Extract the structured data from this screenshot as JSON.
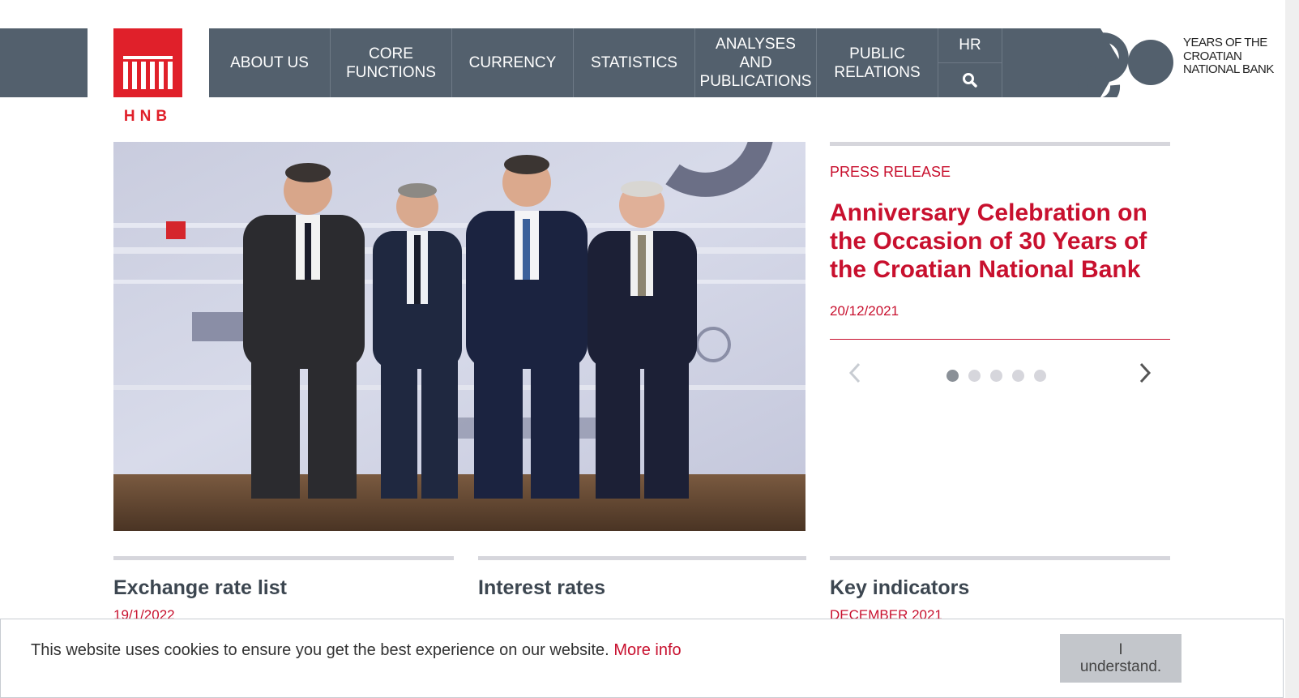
{
  "brand": {
    "logo_text": "HNB",
    "anniversary_number": "30",
    "anniversary_text": "YEARS OF THE CROATIAN NATIONAL BANK",
    "red": "#e0202a",
    "nav_bg": "#53606d"
  },
  "nav": {
    "items": [
      {
        "label": "ABOUT US"
      },
      {
        "label": "CORE\nFUNCTIONS"
      },
      {
        "label": "CURRENCY"
      },
      {
        "label": "STATISTICS"
      },
      {
        "label": "ANALYSES\nAND\nPUBLICATIONS"
      },
      {
        "label": "PUBLIC\nRELATIONS"
      }
    ],
    "language": "HR",
    "search_icon": "search-icon"
  },
  "hero": {
    "image": "photo-four-men-in-suits"
  },
  "press": {
    "label": "PRESS RELEASE",
    "title": "Anniversary Celebration on the Occasion of 30 Years of the Croatian National Bank",
    "date": "20/12/2021",
    "slide_count": 5,
    "active_slide": 1
  },
  "sections": [
    {
      "title": "Exchange rate list",
      "subtitle": "19/1/2022"
    },
    {
      "title": "Interest rates",
      "subtitle": ""
    },
    {
      "title": "Key indicators",
      "subtitle": "DECEMBER 2021"
    }
  ],
  "cookie": {
    "text": "This website uses cookies to ensure you get the best experience on our website.",
    "more_info": "More info",
    "button": "I\nunderstand."
  }
}
